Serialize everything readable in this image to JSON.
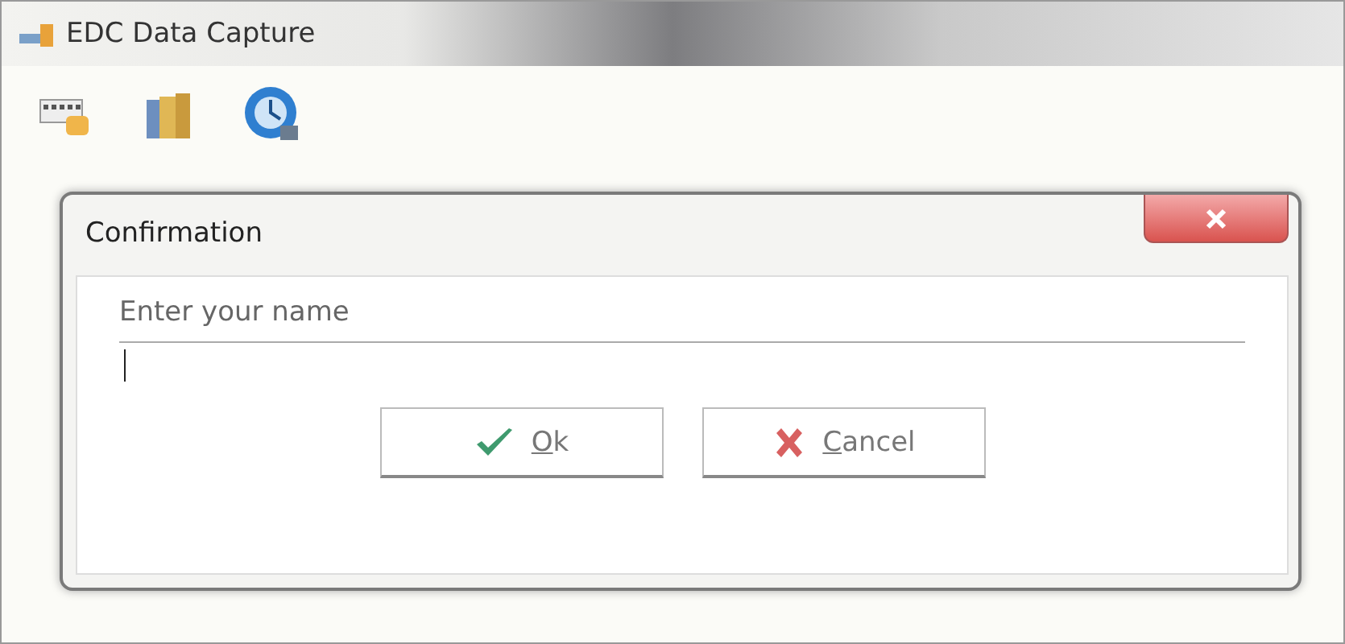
{
  "window": {
    "title": "EDC Data Capture"
  },
  "toolbar": [
    {
      "kind": "keyboard"
    },
    {
      "kind": "books"
    },
    {
      "kind": "clock"
    }
  ],
  "dialog": {
    "title": "Confirmation",
    "field": {
      "label": "Enter your name",
      "focused": true
    },
    "buttons": [
      {
        "kind": "ok",
        "label": "Ok",
        "access_key_underlined": true
      },
      {
        "kind": "cancel",
        "label": "Cancel",
        "access_key_underlined": true
      }
    ]
  }
}
